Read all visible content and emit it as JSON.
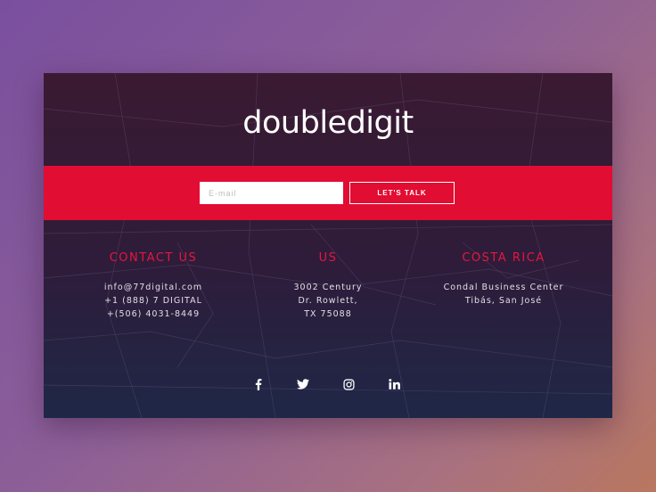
{
  "brand": {
    "logo_text": "doubledigit"
  },
  "signup": {
    "email_placeholder": "E-mail",
    "cta_label": "LET'S TALK"
  },
  "columns": [
    {
      "title": "CONTACT US",
      "lines": [
        "info@77digital.com",
        "+1 (888) 7 DIGITAL",
        "+(506) 4031-8449"
      ]
    },
    {
      "title": "US",
      "lines": [
        "3002 Century",
        "Dr. Rowlett,",
        "TX 75088"
      ]
    },
    {
      "title": "COSTA RICA",
      "lines": [
        "Condal Business Center",
        "Tibás, San José"
      ]
    }
  ],
  "social": [
    "facebook-icon",
    "twitter-icon",
    "instagram-icon",
    "linkedin-icon"
  ],
  "colors": {
    "accent": "#e20d33",
    "card_top": "#3a1a32",
    "card_bottom": "#1f2747",
    "text": "#ffffff"
  }
}
